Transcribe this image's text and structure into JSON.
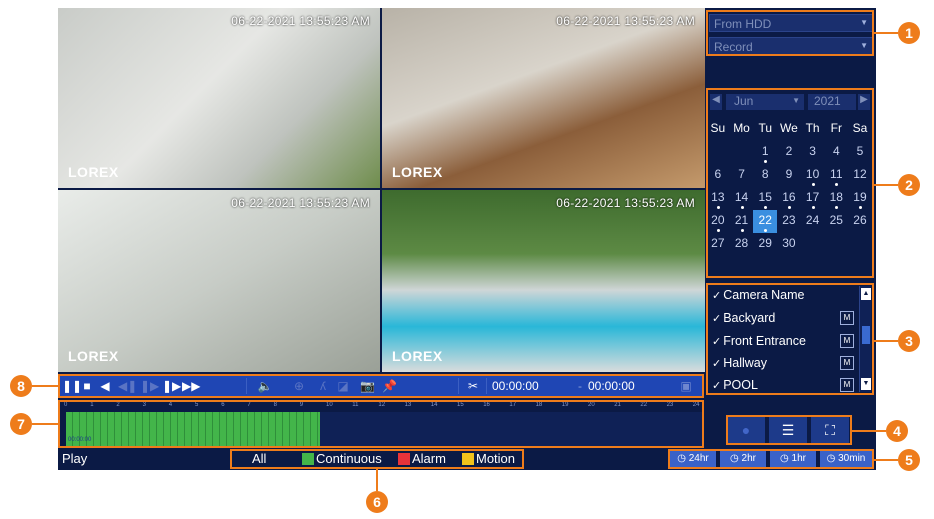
{
  "cameras": [
    {
      "timestamp": "06-22-2021 13:55:23 AM",
      "brand": "LOREX"
    },
    {
      "timestamp": "06-22-2021 13:55:23 AM",
      "brand": "LOREX"
    },
    {
      "timestamp": "06-22-2021 13:55:23 AM",
      "brand": "LOREX"
    },
    {
      "timestamp": "06-22-2021 13:55:23 AM",
      "brand": "LOREX"
    }
  ],
  "source": {
    "value": "From HDD"
  },
  "mode": {
    "value": "Record"
  },
  "calendar": {
    "month": "Jun",
    "year": "2021",
    "weekdays": [
      "Su",
      "Mo",
      "Tu",
      "We",
      "Th",
      "Fr",
      "Sa"
    ],
    "weeks": [
      [
        "",
        "",
        "1",
        "2",
        "3",
        "4",
        "5"
      ],
      [
        "6",
        "7",
        "8",
        "9",
        "10",
        "11",
        "12"
      ],
      [
        "13",
        "14",
        "15",
        "16",
        "17",
        "18",
        "19"
      ],
      [
        "20",
        "21",
        "22",
        "23",
        "24",
        "25",
        "26"
      ],
      [
        "27",
        "28",
        "29",
        "30",
        "",
        "",
        ""
      ]
    ],
    "selected_day": "22"
  },
  "camera_list": {
    "header": "Camera Name",
    "items": [
      "Backyard",
      "Front Entrance",
      "Hallway",
      "POOL"
    ],
    "m_label": "M"
  },
  "toolbar": {
    "start_time": "00:00:00",
    "end_time": "00:00:00"
  },
  "timeline": {
    "hours": [
      "0",
      "1",
      "2",
      "3",
      "4",
      "5",
      "6",
      "7",
      "8",
      "9",
      "10",
      "11",
      "12",
      "13",
      "14",
      "15",
      "16",
      "17",
      "18",
      "19",
      "20",
      "21",
      "22",
      "23",
      "24"
    ],
    "bar_label": "00:00:00"
  },
  "status": {
    "play": "Play"
  },
  "legend": {
    "all": "All",
    "continuous": "Continuous",
    "alarm": "Alarm",
    "motion": "Motion"
  },
  "colors": {
    "continuous": "#43b54a",
    "alarm": "#e8333a",
    "motion": "#f2c21b",
    "accent": "#ee7c1b"
  },
  "timespans": [
    "24hr",
    "2hr",
    "1hr",
    "30min"
  ],
  "callouts": [
    "1",
    "2",
    "3",
    "4",
    "5",
    "6",
    "7",
    "8"
  ]
}
